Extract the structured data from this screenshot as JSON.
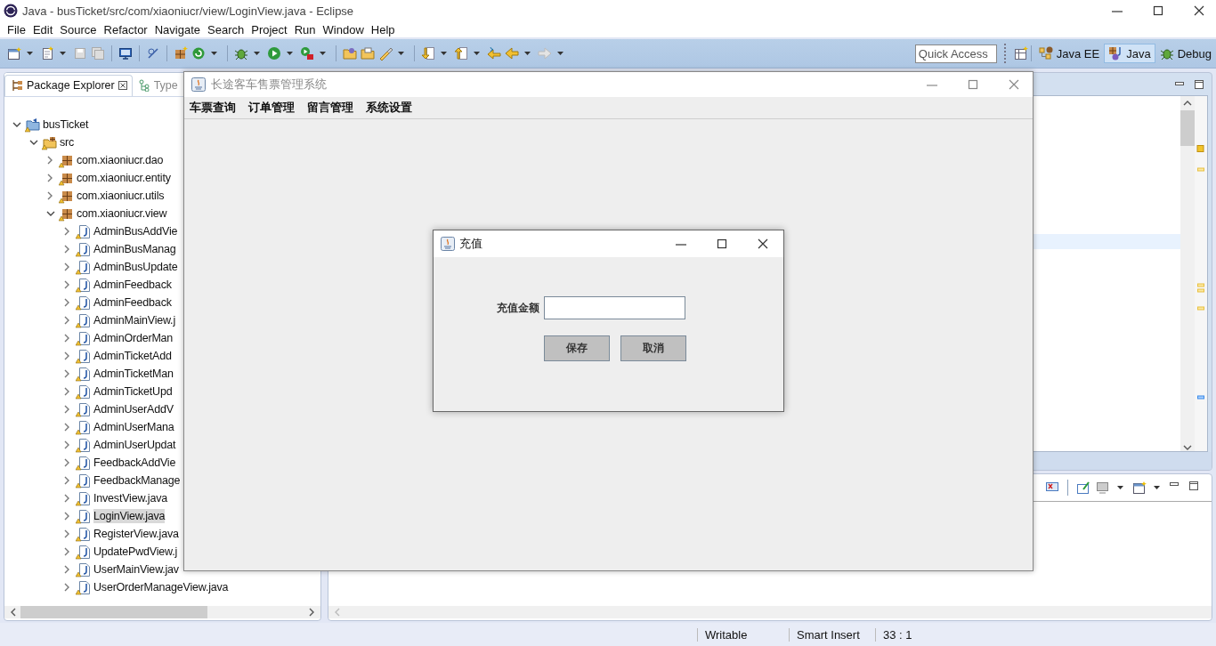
{
  "window": {
    "title": "Java - busTicket/src/com/xiaoniucr/view/LoginView.java - Eclipse"
  },
  "menu": [
    "File",
    "Edit",
    "Source",
    "Refactor",
    "Navigate",
    "Search",
    "Project",
    "Run",
    "Window",
    "Help"
  ],
  "quick_access": {
    "placeholder": "Quick Access"
  },
  "perspectives": [
    {
      "label": "Java EE",
      "selected": false,
      "kind": "javaee"
    },
    {
      "label": "Java",
      "selected": true,
      "kind": "java"
    },
    {
      "label": "Debug",
      "selected": false,
      "kind": "debug"
    }
  ],
  "explorer": {
    "tabs": [
      {
        "label": "Package Explorer",
        "selected": true
      },
      {
        "label": "Type",
        "selected": false
      }
    ],
    "tree": [
      {
        "label": "busTicket",
        "kind": "project",
        "expanded": true,
        "selected": false,
        "children": [
          {
            "label": "src",
            "kind": "source",
            "expanded": true,
            "selected": false,
            "children": [
              {
                "label": "com.xiaoniucr.dao",
                "kind": "package",
                "expanded": false,
                "selected": false
              },
              {
                "label": "com.xiaoniucr.entity",
                "kind": "package",
                "expanded": false,
                "selected": false
              },
              {
                "label": "com.xiaoniucr.utils",
                "kind": "package",
                "expanded": false,
                "selected": false
              },
              {
                "label": "com.xiaoniucr.view",
                "kind": "package",
                "expanded": true,
                "selected": false,
                "children": [
                  {
                    "label": "AdminBusAddVie",
                    "kind": "file",
                    "expanded": false,
                    "selected": false
                  },
                  {
                    "label": "AdminBusManag",
                    "kind": "file",
                    "expanded": false,
                    "selected": false
                  },
                  {
                    "label": "AdminBusUpdate",
                    "kind": "file",
                    "expanded": false,
                    "selected": false
                  },
                  {
                    "label": "AdminFeedback",
                    "kind": "file",
                    "expanded": false,
                    "selected": false
                  },
                  {
                    "label": "AdminFeedback",
                    "kind": "file",
                    "expanded": false,
                    "selected": false
                  },
                  {
                    "label": "AdminMainView.j",
                    "kind": "file",
                    "expanded": false,
                    "selected": false
                  },
                  {
                    "label": "AdminOrderMan",
                    "kind": "file",
                    "expanded": false,
                    "selected": false
                  },
                  {
                    "label": "AdminTicketAdd",
                    "kind": "file",
                    "expanded": false,
                    "selected": false
                  },
                  {
                    "label": "AdminTicketMan",
                    "kind": "file",
                    "expanded": false,
                    "selected": false
                  },
                  {
                    "label": "AdminTicketUpd",
                    "kind": "file",
                    "expanded": false,
                    "selected": false
                  },
                  {
                    "label": "AdminUserAddV",
                    "kind": "file",
                    "expanded": false,
                    "selected": false
                  },
                  {
                    "label": "AdminUserMana",
                    "kind": "file",
                    "expanded": false,
                    "selected": false
                  },
                  {
                    "label": "AdminUserUpdat",
                    "kind": "file",
                    "expanded": false,
                    "selected": false
                  },
                  {
                    "label": "FeedbackAddVie",
                    "kind": "file",
                    "expanded": false,
                    "selected": false
                  },
                  {
                    "label": "FeedbackManage",
                    "kind": "file",
                    "expanded": false,
                    "selected": false
                  },
                  {
                    "label": "InvestView.java",
                    "kind": "file",
                    "expanded": false,
                    "selected": false
                  },
                  {
                    "label": "LoginView.java",
                    "kind": "file",
                    "expanded": false,
                    "selected": true
                  },
                  {
                    "label": "RegisterView.java",
                    "kind": "file",
                    "expanded": false,
                    "selected": false
                  },
                  {
                    "label": "UpdatePwdView.j",
                    "kind": "file",
                    "expanded": false,
                    "selected": false
                  },
                  {
                    "label": "UserMainView.jav",
                    "kind": "file",
                    "expanded": false,
                    "selected": false
                  },
                  {
                    "label": "UserOrderManageView.java",
                    "kind": "file",
                    "expanded": false,
                    "selected": false
                  }
                ]
              }
            ]
          }
        ]
      }
    ]
  },
  "status_bar": [
    "Writable",
    "Smart Insert",
    "33 : 1"
  ],
  "app_window": {
    "title": "长途客车售票管理系统",
    "menu": [
      "车票查询",
      "订单管理",
      "留言管理",
      "系统设置"
    ]
  },
  "dialog": {
    "title": "充值",
    "field": {
      "label": "充值金额"
    },
    "buttons": [
      "保存",
      "取消"
    ]
  }
}
